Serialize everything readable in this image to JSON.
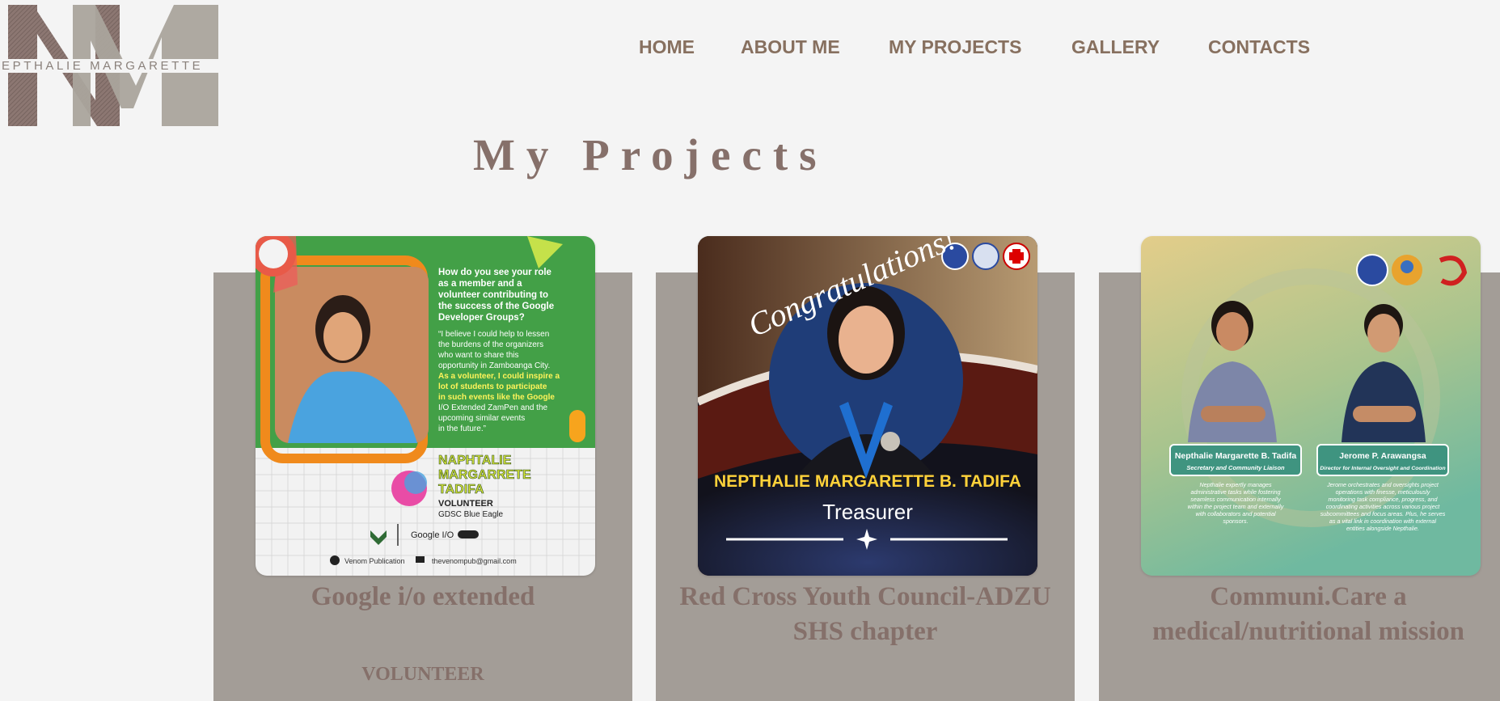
{
  "logo": {
    "monogram": "NM",
    "name_text": "EPTHALIE MARGARETTE"
  },
  "nav": {
    "items": [
      {
        "label": "HOME"
      },
      {
        "label": "ABOUT ME"
      },
      {
        "label": "MY PROJECTS"
      },
      {
        "label": "GALLERY"
      },
      {
        "label": "CONTACTS"
      }
    ]
  },
  "page": {
    "title": "My Projects"
  },
  "colors": {
    "background": "#f4f4f4",
    "accent_brown": "#87705f",
    "card_bg": "#a39d97"
  },
  "cards": [
    {
      "title": "Google i/o extended",
      "role": "VOLUNTEER",
      "poster": {
        "question": "How do you see your role as a member and a volunteer contributing to the success of the Google Developer Groups?",
        "quote_lines": [
          "“I believe I could help to lessen",
          "the burdens of the organizers",
          "who want to share this",
          "opportunity in Zamboanga City.",
          "As a volunteer, I could inspire a",
          "lot of students to participate",
          "in such events like the Google",
          "I/O Extended ZamPen and the",
          "upcoming similar events",
          "in the future.”"
        ],
        "name_lines": [
          "NAPHTALIE",
          "MARGARRETE",
          "TADIFA"
        ],
        "position": "VOLUNTEER",
        "org": "GDSC Blue Eagle",
        "footer_brand": "Google I/O",
        "footer_left": "Venom Publication",
        "footer_right": "thevenompub@gmail.com"
      }
    },
    {
      "title": "Red Cross Youth Council-ADZU SHS chapter",
      "role": "",
      "poster": {
        "script": "Congratulations!",
        "name": "NEPTHALIE MARGARETTE B. TADIFA",
        "position": "Treasurer"
      }
    },
    {
      "title": "Communi.Care a medical/nutritional mission",
      "role": "",
      "poster": {
        "left_name": "Nepthalie Margarette B. Tadifa",
        "left_role": "Secretary and Community Liaison",
        "left_desc": [
          "Nepthalie expertly manages",
          "administrative tasks while fostering",
          "seamless communication internally",
          "within the project team and externally",
          "with collaborators and potential",
          "sponsors."
        ],
        "right_name": "Jerome P. Arawangsa",
        "right_role": "Director for Internal Oversight and Coordination",
        "right_desc": [
          "Jerome orchestrates and oversights project",
          "operations with finesse, meticulously",
          "monitoring task compliance, progress, and",
          "coordinating activities across various project",
          "subcommittees and focus areas. Plus, he serves",
          "as a vital link in coordination with external",
          "entities alongside Nepthalie."
        ]
      }
    }
  ]
}
